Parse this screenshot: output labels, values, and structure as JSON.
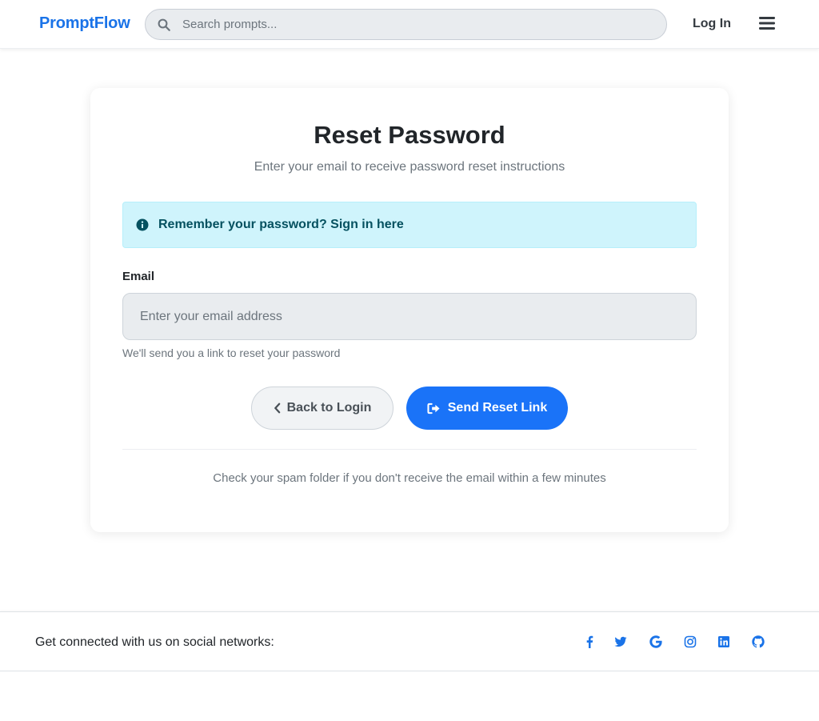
{
  "navbar": {
    "brand": "PromptFlow",
    "search_placeholder": "Search prompts...",
    "login_label": "Log In",
    "icons": {
      "search": "search-icon",
      "menu": "hamburger-menu-icon"
    }
  },
  "card": {
    "title": "Reset Password",
    "subtitle": "Enter your email to receive password reset instructions",
    "alert": {
      "text": "Remember your password? Sign in here",
      "icon": "info-circle-icon"
    },
    "email": {
      "label": "Email",
      "placeholder": "Enter your email address",
      "value": "",
      "help": "We'll send you a link to reset your password"
    },
    "buttons": {
      "back_label": "Back to Login",
      "send_label": "Send Reset Link"
    },
    "note": "Check your spam folder if you don't receive the email within a few minutes"
  },
  "footer": {
    "text": "Get connected with us on social networks:",
    "social": [
      "facebook-icon",
      "twitter-icon",
      "google-icon",
      "instagram-icon",
      "linkedin-icon",
      "github-icon"
    ]
  },
  "colors": {
    "brand": "#1a73e8",
    "primary_button": "#1a73f8",
    "alert_bg": "#cff4fc",
    "alert_text": "#055160"
  }
}
